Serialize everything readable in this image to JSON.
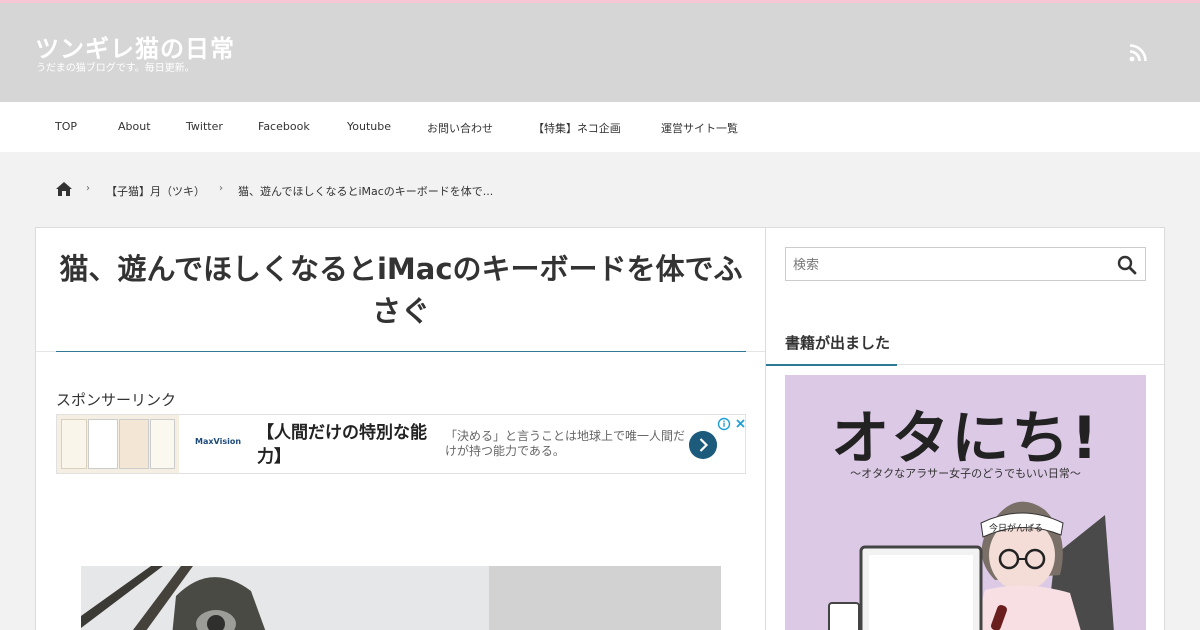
{
  "header": {
    "site_title": "ツンギレ猫の日常",
    "site_description": "うだまの猫ブログです。毎日更新。",
    "rss_icon": "rss-icon",
    "background": "#d6d6d6",
    "top_accent": "#f7c7d3"
  },
  "nav": {
    "items": [
      {
        "label": "TOP"
      },
      {
        "label": "About"
      },
      {
        "label": "Twitter"
      },
      {
        "label": "Facebook"
      },
      {
        "label": "Youtube"
      },
      {
        "label": "お問い合わせ"
      },
      {
        "label": "【特集】ネコ企画"
      },
      {
        "label": "運営サイト一覧"
      }
    ]
  },
  "breadcrumb": {
    "home_icon": "home-icon",
    "separator": "›",
    "items": [
      {
        "label": "【子猫】月（ツキ）"
      },
      {
        "label": "猫、遊んでほしくなるとiMacのキーボードを体で..."
      }
    ]
  },
  "article": {
    "title": "猫、遊んでほしくなるとiMacのキーボードを体でふさぐ",
    "sponsor_label": "スポンサーリンク",
    "accent": "#2e7a95",
    "ad": {
      "logo": "MaxVision",
      "headline": "【人間だけの特別な能力】",
      "text": "「決める」と言うことは地球上で唯一人間だけが持つ能力である。",
      "button_color": "#1d5b7c"
    }
  },
  "sidebar": {
    "search": {
      "placeholder": "検索",
      "icon": "search-icon"
    },
    "books_heading": "書籍が出ました",
    "book": {
      "title": "オタにち!",
      "subtitle": "〜オタクなアラサー女子のどうでもいい日常〜",
      "headband": "今日がんばる",
      "background": "#dcc9e6"
    }
  }
}
